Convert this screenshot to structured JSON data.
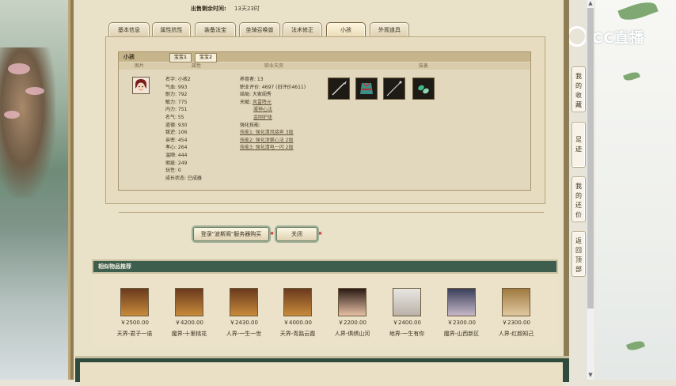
{
  "sale_time": {
    "label": "出售剩余时间:",
    "value": "13天23时"
  },
  "tabs": [
    {
      "label": "基本信息",
      "active": false
    },
    {
      "label": "属性抗性",
      "active": false
    },
    {
      "label": "装备法宝",
      "active": false
    },
    {
      "label": "坐骑召唤兽",
      "active": false
    },
    {
      "label": "法术修正",
      "active": false
    },
    {
      "label": "小孩",
      "active": true
    },
    {
      "label": "外观道具",
      "active": false
    }
  ],
  "child_panel": {
    "title": "小孩",
    "subtabs": [
      "宝宝1",
      "宝宝2"
    ],
    "active_subtab": 1,
    "columns": [
      "图片",
      "属性",
      "职业天资",
      "装备"
    ],
    "attributes": [
      "名字: 小孩2",
      "气血: 993",
      "耐力: 792",
      "敏力: 775",
      "内力: 751",
      "名气: 55",
      "道德: 930",
      "叛逆: 106",
      "亲密: 454",
      "孝心: 264",
      "温顺: 444",
      "瑕疵: 249",
      "玩性: 0",
      "成长状态: 已成器"
    ],
    "aptitude": {
      "grow": "养育者: 13",
      "score": "职业评价: 4697 (旧评价4611)",
      "ending": "结局: 大家闺秀",
      "talent_label": "天赋:",
      "talents": [
        "风雷降元",
        "凝神心法",
        "金刚护体"
      ],
      "enhance_label": "强化技能:",
      "enhance": [
        "技能1: 强化清风接奔 3级",
        "技能2: 强化涅槃心法 2级",
        "技能3: 强化清电一闪 2级"
      ]
    },
    "equipment_icons": [
      "spear-icon",
      "armor-icon",
      "staff-icon",
      "jade-icon"
    ]
  },
  "buttons": {
    "buy": "登录\"波斯阁\"服务器购买",
    "close": "关闭"
  },
  "similar": {
    "title": "相似物品推荐",
    "items": [
      {
        "price": "￥2500.00",
        "name": "天界-君子一诺",
        "portrait": "warrior-portrait-icon"
      },
      {
        "price": "￥4200.00",
        "name": "魔界-十里桃花",
        "portrait": "warrior-portrait-icon"
      },
      {
        "price": "￥2430.00",
        "name": "人界-一生一世",
        "portrait": "warrior-portrait-icon"
      },
      {
        "price": "￥4000.00",
        "name": "天界-青路云霞",
        "portrait": "warrior-portrait-icon"
      },
      {
        "price": "￥2200.00",
        "name": "人界-俱绣山河",
        "portrait": "lady-portrait-icon"
      },
      {
        "price": "￥2400.00",
        "name": "地界-一生有你",
        "portrait": "elder-portrait-icon"
      },
      {
        "price": "￥2300.00",
        "name": "魔界-山西新区",
        "portrait": "demon-portrait-icon"
      },
      {
        "price": "￥2300.00",
        "name": "人界-红颜知己",
        "portrait": "sage-portrait-icon"
      }
    ]
  },
  "side_nav": [
    "我的收藏",
    "足迹",
    "我的还价",
    "返回顶部"
  ],
  "logo": {
    "text": "CC直播"
  }
}
